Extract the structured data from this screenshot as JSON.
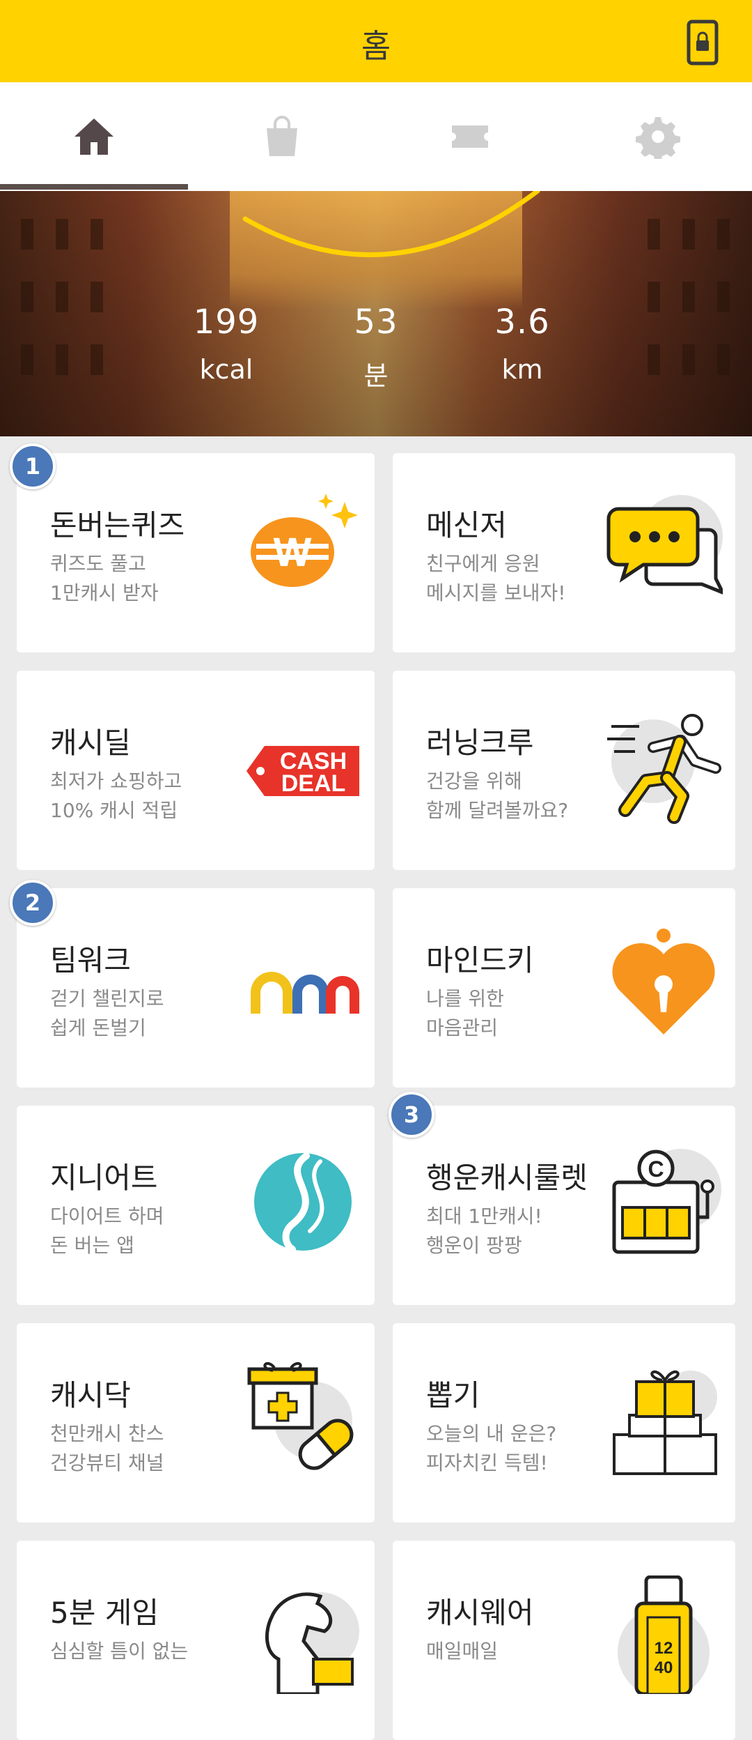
{
  "header": {
    "title": "홈"
  },
  "tabs": [
    {
      "icon": "home-icon",
      "active": true
    },
    {
      "icon": "shopping-bag-icon",
      "active": false
    },
    {
      "icon": "ticket-icon",
      "active": false
    },
    {
      "icon": "gear-icon",
      "active": false
    }
  ],
  "banner": {
    "stats": [
      {
        "value": "199",
        "unit": "kcal"
      },
      {
        "value": "53",
        "unit": "분"
      },
      {
        "value": "3.6",
        "unit": "km"
      }
    ]
  },
  "badges": [
    "1",
    "2",
    "3"
  ],
  "cards": [
    {
      "title": "돈버는퀴즈",
      "desc": "퀴즈도 풀고\n1만캐시 받자",
      "icon": "won-coin-icon"
    },
    {
      "title": "메신저",
      "desc": "친구에게 응원\n메시지를 보내자!",
      "icon": "chat-bubble-icon"
    },
    {
      "title": "캐시딜",
      "desc": "최저가 쇼핑하고\n10% 캐시 적립",
      "icon": "cash-deal-tag-icon",
      "icon_text": [
        "CASH",
        "DEAL"
      ]
    },
    {
      "title": "러닝크루",
      "desc": "건강을 위해\n함께 달려볼까요?",
      "icon": "runner-icon"
    },
    {
      "title": "팀워크",
      "desc": "걷기 챌린지로\n쉽게 돈벌기",
      "icon": "teamwork-arches-icon"
    },
    {
      "title": "마인드키",
      "desc": "나를 위한\n마음관리",
      "icon": "heart-keyhole-icon"
    },
    {
      "title": "지니어트",
      "desc": "다이어트 하며\n돈 버는 앱",
      "icon": "genie-diet-logo-icon"
    },
    {
      "title": "행운캐시룰렛",
      "desc": "최대 1만캐시!\n행운이 팡팡",
      "icon": "slot-machine-icon"
    },
    {
      "title": "캐시닥",
      "desc": "천만캐시 찬스\n건강뷰티 채널",
      "icon": "medicine-box-pill-icon"
    },
    {
      "title": "뽑기",
      "desc": "오늘의 내 운은?\n피자치킨 득템!",
      "icon": "gift-stack-icon"
    },
    {
      "title": "5분 게임",
      "desc": "심심할 틈이 없는\n",
      "icon": "chess-knight-icon"
    },
    {
      "title": "캐시웨어",
      "desc": "매일매일\n",
      "icon": "smartwatch-icon",
      "icon_text": [
        "12",
        "40"
      ]
    }
  ],
  "colors": {
    "accent": "#ffd200",
    "badge": "#4a78b8",
    "orange": "#f7941d",
    "teal": "#3fbcc4"
  }
}
